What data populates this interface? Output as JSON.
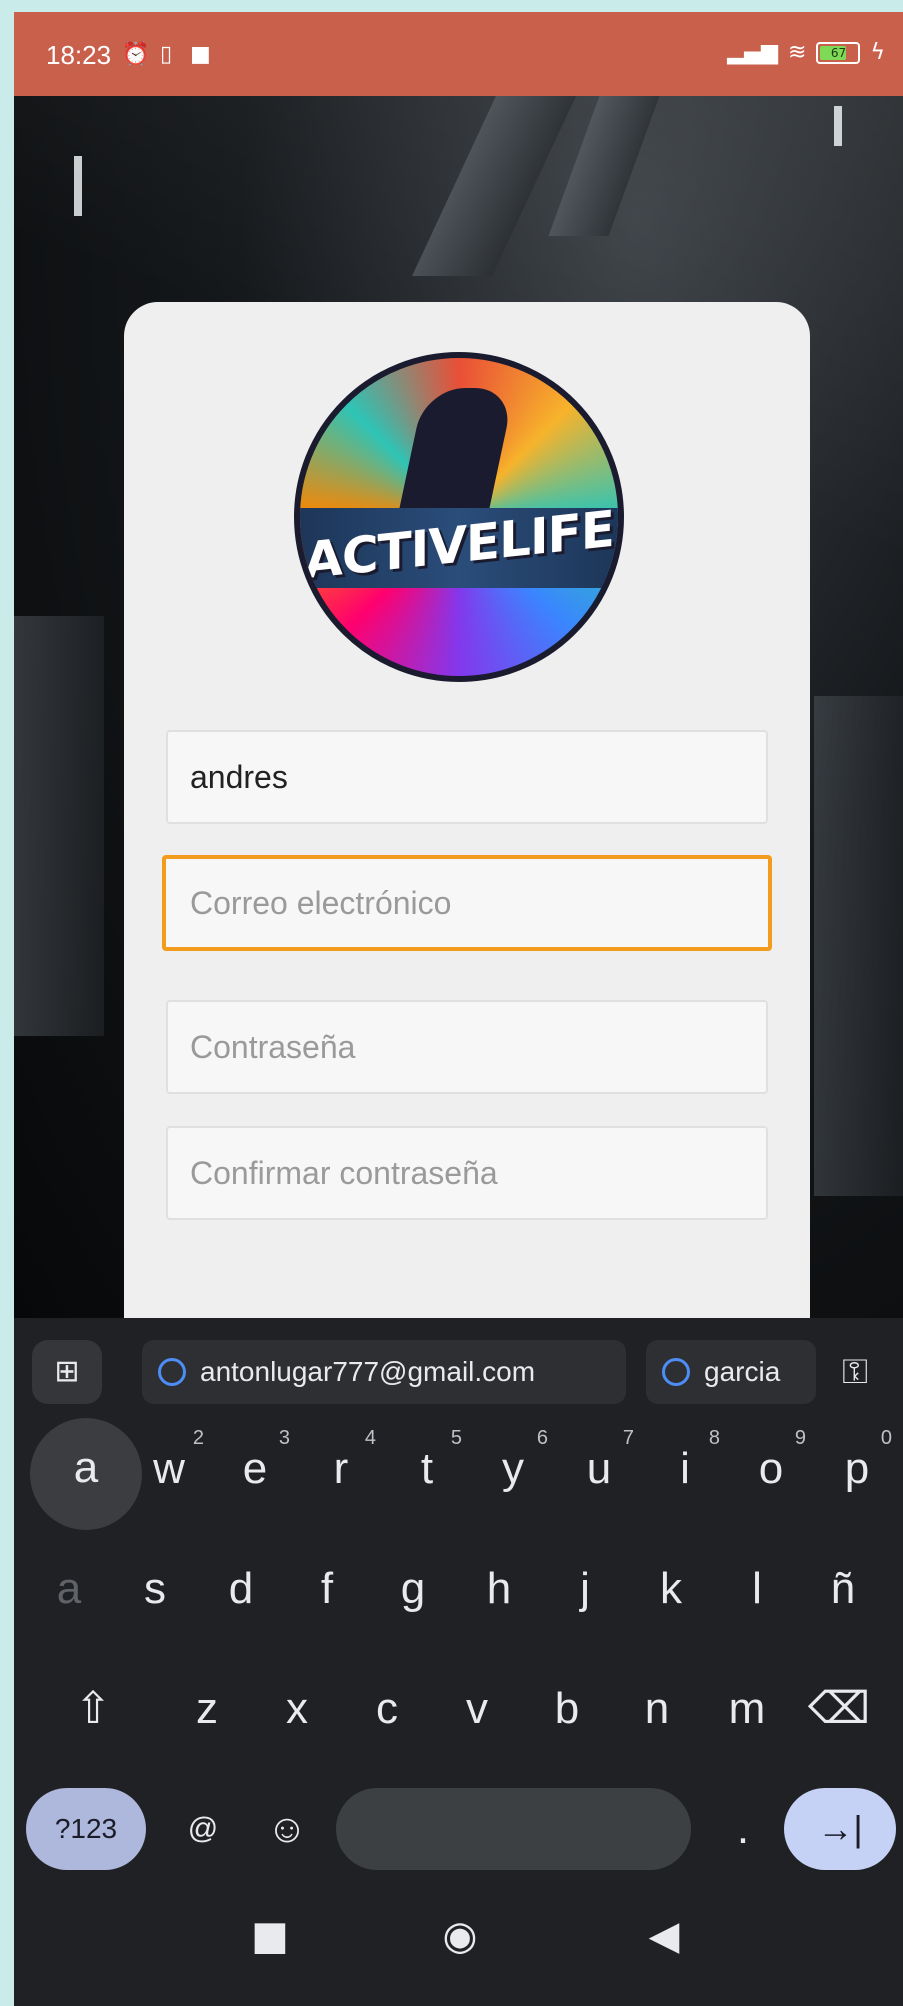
{
  "status_bar": {
    "time": "18:23",
    "battery_level": "67",
    "icons": [
      "alarm-off-icon",
      "sim-icon",
      "video-icon",
      "signal-icon",
      "wifi-icon",
      "battery-icon",
      "charging-icon"
    ]
  },
  "form": {
    "logo_text": "ACTIVELIFE",
    "name_value": "andres",
    "email_placeholder": "Correo electrónico",
    "password_placeholder": "Contraseña",
    "confirm_placeholder": "Confirmar contraseña"
  },
  "keyboard": {
    "suggestions": [
      "antonlugar777@gmail.com",
      "garcia"
    ],
    "row1": [
      {
        "key": "a",
        "hint": ""
      },
      {
        "key": "w",
        "hint": "2"
      },
      {
        "key": "e",
        "hint": "3"
      },
      {
        "key": "r",
        "hint": "4"
      },
      {
        "key": "t",
        "hint": "5"
      },
      {
        "key": "y",
        "hint": "6"
      },
      {
        "key": "u",
        "hint": "7"
      },
      {
        "key": "i",
        "hint": "8"
      },
      {
        "key": "o",
        "hint": "9"
      },
      {
        "key": "p",
        "hint": "0"
      }
    ],
    "row2": [
      "a",
      "s",
      "d",
      "f",
      "g",
      "h",
      "j",
      "k",
      "l",
      "ñ"
    ],
    "row3": [
      "z",
      "x",
      "c",
      "v",
      "b",
      "n",
      "m"
    ],
    "symbols_label": "?123",
    "at_label": "@",
    "period_label": ".",
    "enter_glyph": "→|"
  },
  "colors": {
    "status_bar": "#c9604c",
    "focus_border": "#f39b1c",
    "keyboard_bg": "#202124",
    "frame_bg": "#c9ecea"
  }
}
